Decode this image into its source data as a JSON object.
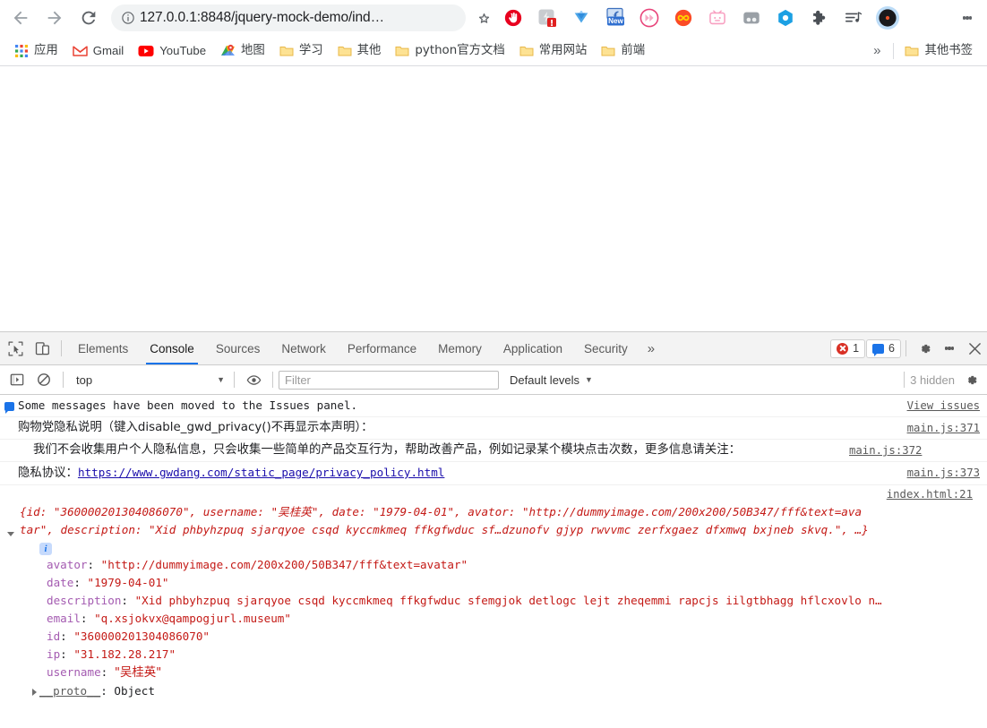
{
  "browser": {
    "nav": {
      "back_label": "Back",
      "forward_label": "Forward",
      "reload_label": "Reload"
    },
    "omnibox": {
      "url": "127.0.0.1:8848/jquery-mock-demo/ind…",
      "info_icon": "info-circle-icon",
      "star_icon": "star-outline-icon"
    },
    "extensions": [
      {
        "name": "adblock-icon"
      },
      {
        "name": "extension-warning-icon",
        "badge": "!"
      },
      {
        "name": "tampermonkey-icon"
      },
      {
        "name": "new-feature-icon",
        "badge": "New"
      },
      {
        "name": "video-speed-icon"
      },
      {
        "name": "infinity-icon"
      },
      {
        "name": "bilibili-tv-icon"
      },
      {
        "name": "grey-capsule-icon"
      },
      {
        "name": "blue-hexagon-icon"
      },
      {
        "name": "puzzle-piece-icon"
      },
      {
        "name": "playlist-icon"
      },
      {
        "name": "vinyl-record-icon"
      }
    ],
    "menu_icon": "chrome-menu-kebab-icon",
    "bookmarks": [
      {
        "label": "应用",
        "icon": "apps-grid-icon"
      },
      {
        "label": "Gmail",
        "icon": "gmail-icon"
      },
      {
        "label": "YouTube",
        "icon": "youtube-icon"
      },
      {
        "label": "地图",
        "icon": "google-maps-icon"
      },
      {
        "label": "学习",
        "icon": "folder-icon"
      },
      {
        "label": "其他",
        "icon": "folder-icon"
      },
      {
        "label": "python官方文档",
        "icon": "folder-icon"
      },
      {
        "label": "常用网站",
        "icon": "folder-icon"
      },
      {
        "label": "前端",
        "icon": "folder-icon"
      }
    ],
    "bookmarks_overflow": "»",
    "other_bookmarks": {
      "label": "其他书签",
      "icon": "folder-icon"
    }
  },
  "devtools": {
    "inspect_icon": "inspect-element-icon",
    "device_icon": "toggle-device-toolbar-icon",
    "tabs": [
      {
        "label": "Elements",
        "active": false
      },
      {
        "label": "Console",
        "active": true
      },
      {
        "label": "Sources",
        "active": false
      },
      {
        "label": "Network",
        "active": false
      },
      {
        "label": "Performance",
        "active": false
      },
      {
        "label": "Memory",
        "active": false
      },
      {
        "label": "Application",
        "active": false
      },
      {
        "label": "Security",
        "active": false
      }
    ],
    "more_tabs": "»",
    "error_count": "1",
    "warning_count": "6",
    "settings_icon": "gear-icon",
    "kebab_icon": "more-options-icon",
    "close_icon": "close-icon",
    "filterbar": {
      "execute_icon": "console-sidebar-icon",
      "clear_icon": "clear-console-icon",
      "context": "top",
      "caret": "▼",
      "eye_icon": "live-expression-eye-icon",
      "filter_placeholder": "Filter",
      "filter_value": "",
      "levels_label": "Default levels",
      "levels_caret": "▼",
      "hidden_label": "3 hidden",
      "console_settings_icon": "gear-icon"
    },
    "messages": [
      {
        "icon": "info-message-flag-icon",
        "text": "Some messages have been moved to the Issues panel.",
        "source": "View issues",
        "cjk": false
      },
      {
        "icon": "",
        "text": "购物党隐私说明（键入disable_gwd_privacy()不再显示本声明）：",
        "source": "main.js:371",
        "cjk": true
      },
      {
        "icon": "",
        "text": "    我们不会收集用户个人隐私信息，只会收集一些简单的产品交互行为，帮助改善产品，例如记录某个模块点击次数，更多信息请关注：",
        "source": "main.js:372",
        "cjk": true
      },
      {
        "icon": "",
        "text": "隐私协议：",
        "link": "https://www.gwdang.com/static_page/privacy_policy.html",
        "source": "main.js:373",
        "cjk": true
      }
    ],
    "object_log": {
      "source": "index.html:21",
      "preview_line1": "{id: \"360000201304086070\", username: \"吴桂英\", date: \"1979-04-01\", avator: \"http://dummyimage.com/200x200/50B347/fff&text=ava",
      "preview_line2": "tar\", description: \"Xid phbyhzpuq sjarqyoe csqd kyccmkmeq ffkgfwduc sf…dzunofv gjyp rwvvmc zerfxgaez dfxmwq bxjneb skvq.\", …}",
      "info_badge": "i",
      "properties": [
        {
          "name": "avator",
          "value": "\"http://dummyimage.com/200x200/50B347/fff&text=avatar\"",
          "type": "string"
        },
        {
          "name": "date",
          "value": "\"1979-04-01\"",
          "type": "string"
        },
        {
          "name": "description",
          "value": "\"Xid phbyhzpuq sjarqyoe csqd kyccmkmeq ffkgfwduc sfemgjok detlogc lejt zheqemmi rapcjs iilgtbhagg hflcxovlo n…",
          "type": "string"
        },
        {
          "name": "email",
          "value": "\"q.xsjokvx@qampogjurl.museum\"",
          "type": "string"
        },
        {
          "name": "id",
          "value": "\"360000201304086070\"",
          "type": "string"
        },
        {
          "name": "ip",
          "value": "\"31.182.28.217\"",
          "type": "string"
        },
        {
          "name": "username",
          "value": "\"吴桂英\"",
          "type": "string"
        }
      ],
      "proto_name": "__proto__",
      "proto_value": "Object"
    }
  },
  "colors": {
    "accent_blue": "#1a73e8",
    "error_red": "#d93025",
    "string_red": "#c41a16",
    "prop_purple": "#a45bb1",
    "link_blue": "#1a0dab"
  }
}
